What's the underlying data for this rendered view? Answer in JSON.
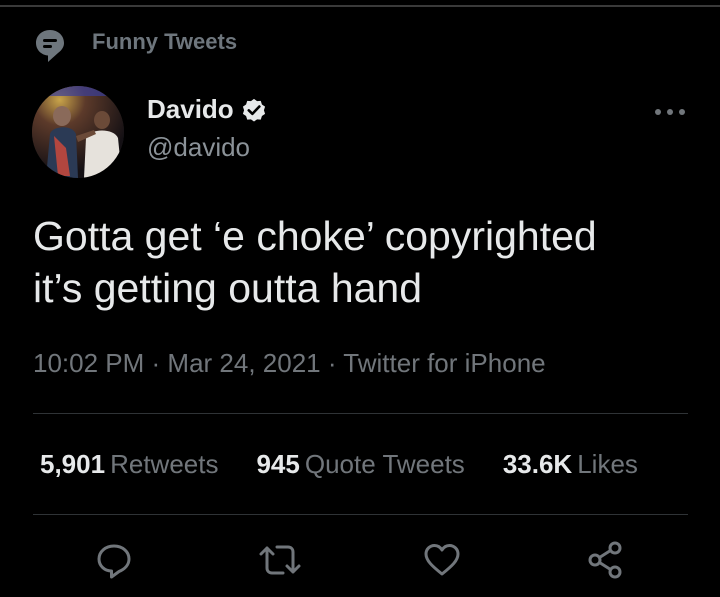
{
  "context": {
    "label": "Funny Tweets",
    "icon": "topic-icon"
  },
  "author": {
    "display_name": "Davido",
    "handle": "@davido",
    "verified": true,
    "avatar_icon": "profile-photo"
  },
  "tweet": {
    "lines": [
      "Gotta get ‘e choke’ copyrighted",
      "it’s getting outta hand"
    ],
    "time": "10:02 PM",
    "date": "Mar 24, 2021",
    "source": "Twitter for iPhone",
    "separator": "·"
  },
  "stats": {
    "retweets_value": "5,901",
    "retweets_label": "Retweets",
    "quotes_value": "945",
    "quotes_label": "Quote Tweets",
    "likes_value": "33.6K",
    "likes_label": "Likes"
  },
  "actions": [
    "reply-icon",
    "retweet-icon",
    "like-icon",
    "share-icon"
  ],
  "colors": {
    "background": "#000000",
    "primary_text": "#e7e9ea",
    "secondary_text": "#71767b",
    "divider": "#2f3336"
  }
}
